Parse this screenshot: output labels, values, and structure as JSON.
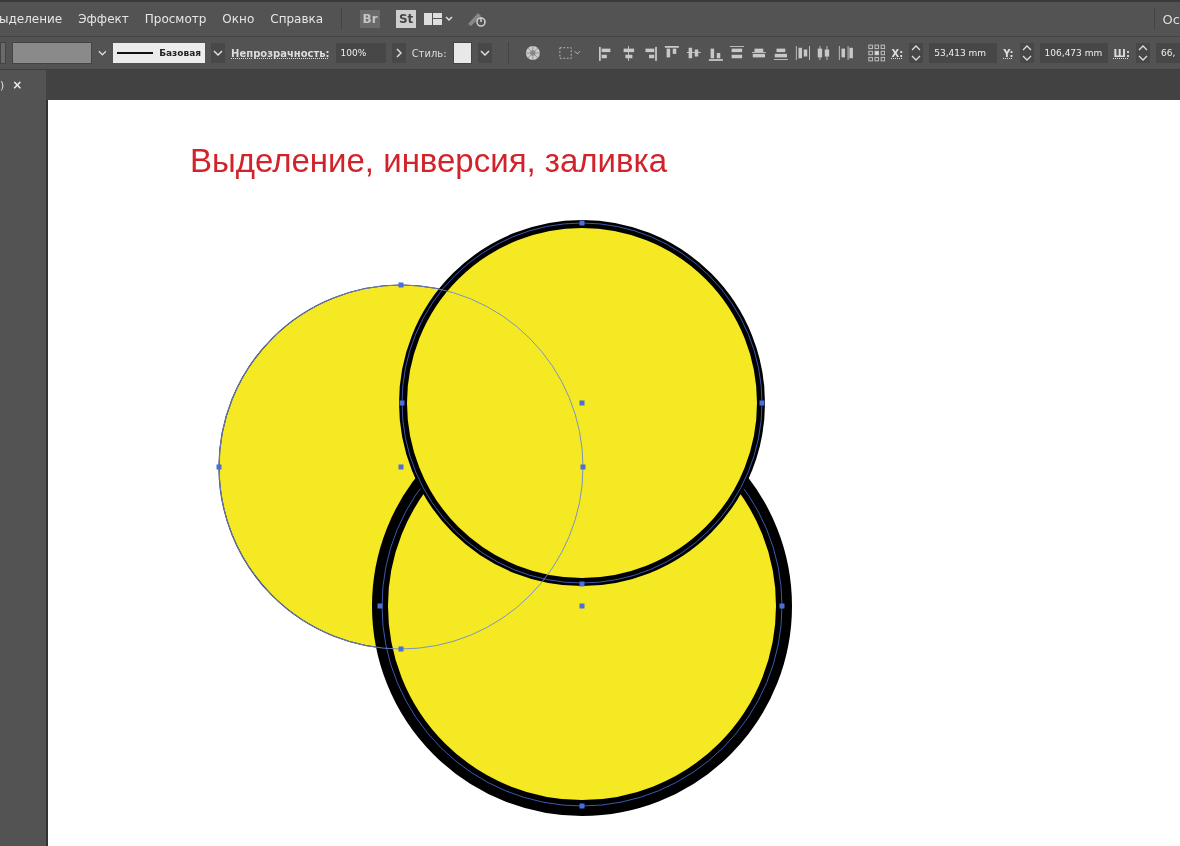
{
  "menu": {
    "items": [
      "ыделение",
      "Эффект",
      "Просмотр",
      "Окно",
      "Справка"
    ],
    "badges": [
      "Br",
      "St"
    ],
    "workspace": "Ос"
  },
  "control_bar": {
    "stroke_profile": "Базовая",
    "opacity_label": "Непрозрачность:",
    "opacity_value": "100%",
    "style_label": "Стиль:",
    "coords": [
      {
        "label": "X:",
        "value": "53,413 mm"
      },
      {
        "label": "Y:",
        "value": "106,473 mm"
      },
      {
        "label": "Ш:",
        "value": "66,"
      }
    ]
  },
  "tab": {
    "label": ")",
    "close": "×"
  },
  "canvas": {
    "title": "Выделение, инверсия, заливка"
  }
}
